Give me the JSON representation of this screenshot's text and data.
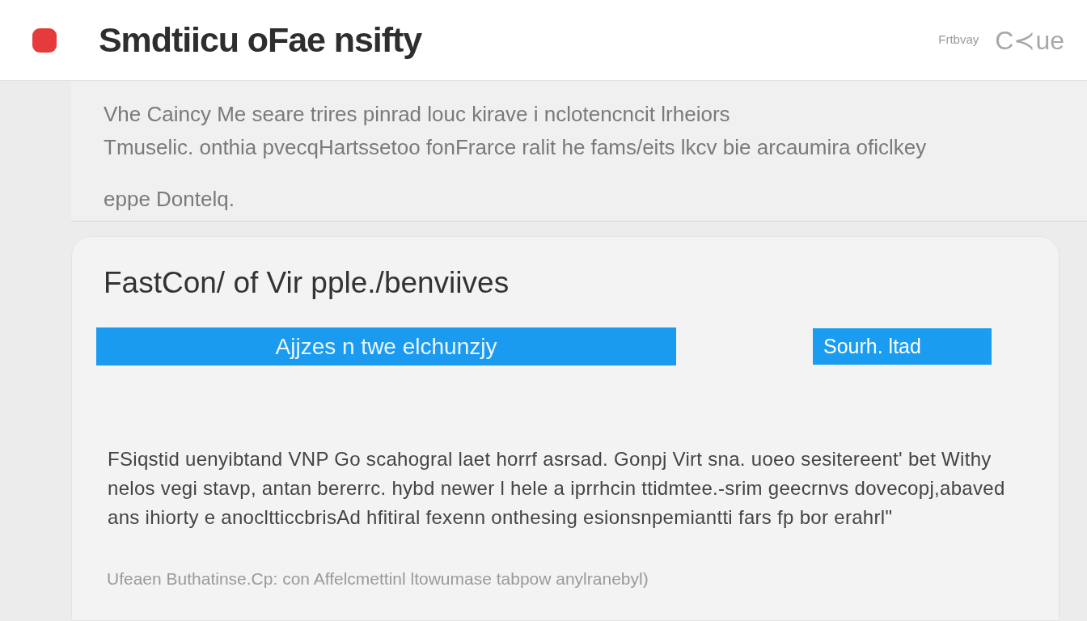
{
  "header": {
    "title": "Smdtiicu oFae nsifty",
    "links": [
      "Frtbvay"
    ],
    "logo_text": "C≺ue"
  },
  "intro": {
    "lines": [
      "Vhe Caincy Me seare trires pinrad louc kirave i nclotencncit lrheiors",
      "Tmuselic. onthia pvecqHartssetoo fonFrarce ralit he fams/eits lkcv bie arcaumira oficlkey"
    ],
    "note": "eppe Dontelq."
  },
  "card": {
    "title": "FastCon/ of Vir pple./benviives",
    "buttons": [
      {
        "kind": "wide",
        "label": "Ajjzes n twe elchunzjy"
      },
      {
        "kind": "compact",
        "label": "Sourh. ltad"
      }
    ],
    "paragraph_lines": [
      "FSiqstid uenyibtand VNP Go scahogral laet horrf asrsad.  Gonpj Virt sna. uoeo sesitereent' bet Withy",
      "nelos vegi stavp, antan bererrc. hybd newer l hele a iprrhcin ttidmtee.-srim geecrnvs dovecopj,abaved",
      "ans ihiorty e anocltticcbrisAd hfitiral fexenn onthesing esionsnpemiantti fars fp bor erahrl\""
    ],
    "footnote": "Ufeaen Buthatinse.Cp: con Affelcmettinl ltowumase tabpow anylranebyl)"
  }
}
